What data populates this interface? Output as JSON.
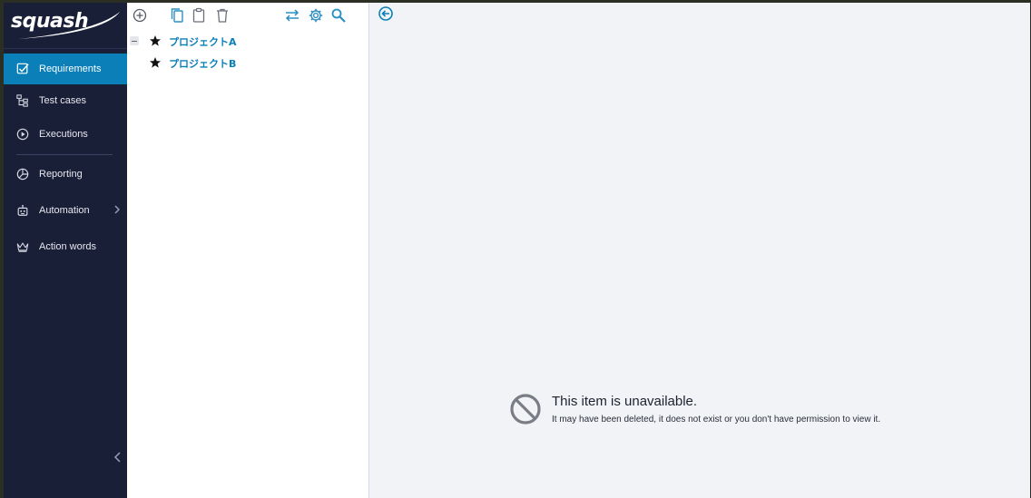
{
  "brand": {
    "logo_text": "squash"
  },
  "sidebar": {
    "items": [
      {
        "label": "Requirements",
        "icon": "checkbox-icon"
      },
      {
        "label": "Test cases",
        "icon": "tree-structure-icon"
      },
      {
        "label": "Executions",
        "icon": "play-circle-icon"
      },
      {
        "label": "Reporting",
        "icon": "pie-chart-icon"
      },
      {
        "label": "Automation",
        "icon": "robot-icon"
      },
      {
        "label": "Action words",
        "icon": "crown-icon"
      }
    ],
    "active_index": 0
  },
  "tree_toolbar": {
    "icons": [
      "add-circle-icon",
      "copy-icon",
      "paste-icon",
      "delete-icon",
      "transfer-icon",
      "settings-icon",
      "search-icon"
    ]
  },
  "tree": {
    "nodes": [
      {
        "label": "プロジェクトA",
        "expanded": true
      },
      {
        "label": "プロジェクトB",
        "expanded": false
      }
    ]
  },
  "main": {
    "unavailable_title": "This item is unavailable.",
    "unavailable_message": "It may have been deleted, it does not exist or you don't have permission to view it."
  },
  "colors": {
    "sidebar_bg": "#1a1f38",
    "accent": "#0b7fb8",
    "content_bg": "#f2f3f7"
  }
}
